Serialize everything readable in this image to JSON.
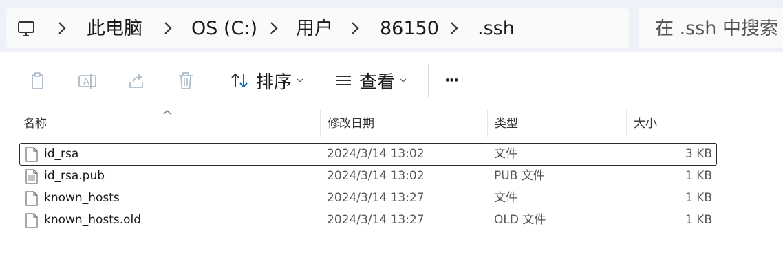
{
  "breadcrumb": {
    "root_icon": "computer-icon",
    "items": [
      {
        "label": "此电脑"
      },
      {
        "label": "OS (C:)"
      },
      {
        "label": "用户"
      },
      {
        "label": "86150"
      },
      {
        "label": ".ssh"
      }
    ]
  },
  "search": {
    "placeholder": "在 .ssh 中搜索"
  },
  "toolbar": {
    "icons": [
      "copy-icon",
      "rename-icon",
      "share-icon",
      "delete-icon"
    ],
    "sort_label": "排序",
    "view_label": "查看",
    "more_label": "···"
  },
  "columns": {
    "name": "名称",
    "date": "修改日期",
    "type": "类型",
    "size": "大小"
  },
  "files": [
    {
      "name": "id_rsa",
      "date": "2024/3/14 13:02",
      "type": "文件",
      "size": "3 KB",
      "icon": "file-icon"
    },
    {
      "name": "id_rsa.pub",
      "date": "2024/3/14 13:02",
      "type": "PUB 文件",
      "size": "1 KB",
      "icon": "text-file-icon"
    },
    {
      "name": "known_hosts",
      "date": "2024/3/14 13:27",
      "type": "文件",
      "size": "1 KB",
      "icon": "file-icon"
    },
    {
      "name": "known_hosts.old",
      "date": "2024/3/14 13:27",
      "type": "OLD 文件",
      "size": "1 KB",
      "icon": "file-icon"
    }
  ],
  "colors": {
    "address_bg": "#eef2f8",
    "focus_border": "#2b2b2b",
    "sort_accent": "#0067c0"
  }
}
